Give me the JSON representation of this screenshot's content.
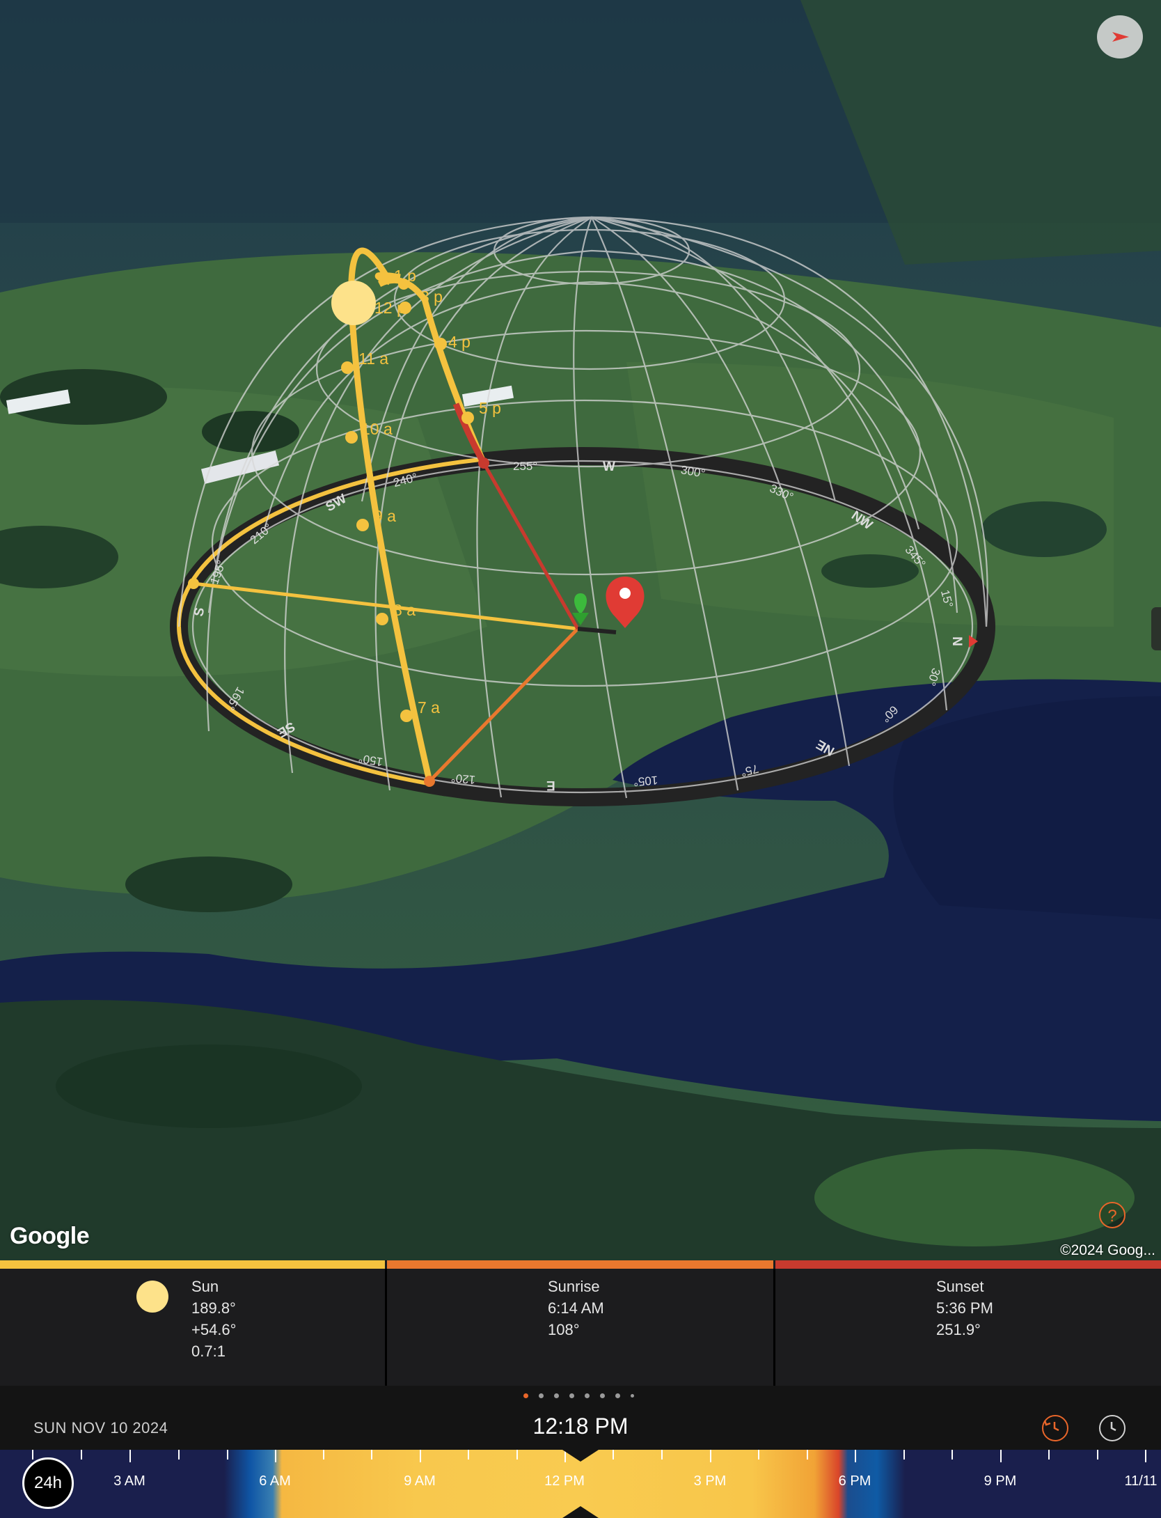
{
  "map": {
    "google_logo": "Google",
    "copyright": "©2024 Goog...",
    "help_icon": "question-circle-icon",
    "compass_icon": "compass-arrow-icon"
  },
  "overlay": {
    "hour_labels_left": [
      "7 a",
      "8 a",
      "9 a",
      "10 a",
      "11 a",
      "12 p",
      "1 p"
    ],
    "hour_labels_right": [
      "3 p",
      "4 p",
      "5 p"
    ],
    "compass_labels": [
      "S",
      "SW",
      "W",
      "NW",
      "N",
      "NE",
      "E",
      "SE",
      "195°",
      "210°",
      "240°",
      "255°",
      "300°",
      "330°",
      "345°",
      "15°",
      "30°",
      "60°",
      "75°",
      "105°",
      "120°",
      "150°",
      "165°"
    ]
  },
  "info": {
    "sun": {
      "label": "Sun",
      "azimuth": "189.8°",
      "altitude": "+54.6°",
      "ratio": "0.7:1"
    },
    "sunrise": {
      "label": "Sunrise",
      "time": "6:14 AM",
      "azimuth": "108°"
    },
    "sunset": {
      "label": "Sunset",
      "time": "5:36 PM",
      "azimuth": "251.9°"
    },
    "colors": {
      "sun": "#f4c23f",
      "sunrise": "#e9782e",
      "sunset": "#c83a2e"
    }
  },
  "footer": {
    "date": "SUN NOV 10 2024",
    "time": "12:18 PM",
    "page_count": 8,
    "active_page": 1
  },
  "timeline": {
    "toggle_label": "24h",
    "labels": [
      "3 AM",
      "6 AM",
      "9 AM",
      "12 PM",
      "3 PM",
      "6 PM",
      "9 PM",
      "11/11"
    ]
  }
}
